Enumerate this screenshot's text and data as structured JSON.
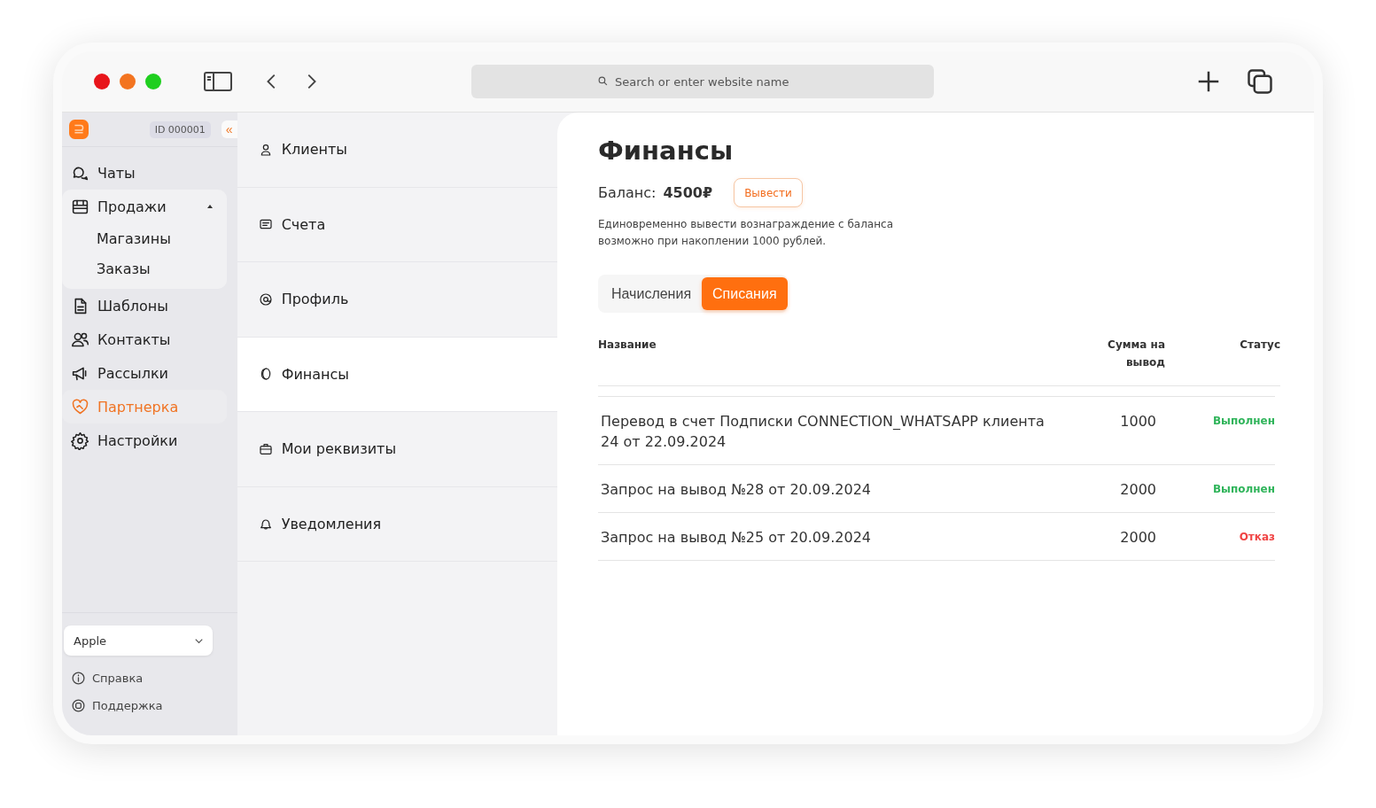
{
  "browser": {
    "search_placeholder": "Search or enter website name"
  },
  "sidebar": {
    "account_id": "ID 000001",
    "collapse": "«",
    "items": [
      {
        "label": "Чаты",
        "kind": "chat",
        "selected": false
      },
      {
        "label": "Продажи",
        "kind": "store",
        "selected": false,
        "expanded": true,
        "children": [
          {
            "label": "Магазины",
            "selected": false
          },
          {
            "label": "Заказы",
            "selected": false
          }
        ]
      },
      {
        "label": "Шаблоны",
        "kind": "doc",
        "selected": false
      },
      {
        "label": "Контакты",
        "kind": "people",
        "selected": false
      },
      {
        "label": "Рассылки",
        "kind": "megaphone",
        "selected": false
      },
      {
        "label": "Партнерка",
        "kind": "heart",
        "selected": true
      },
      {
        "label": "Настройки",
        "kind": "gear",
        "selected": false
      }
    ],
    "company_select": {
      "value": "Apple"
    },
    "footer_links": [
      {
        "label": "Справка",
        "kind": "info"
      },
      {
        "label": "Поддержка",
        "kind": "lifebuoy"
      }
    ]
  },
  "settings_menu": [
    {
      "label": "Клиенты",
      "kind": "user",
      "selected": false
    },
    {
      "label": "Счета",
      "kind": "receipt",
      "selected": false
    },
    {
      "label": "Профиль",
      "kind": "at",
      "selected": false
    },
    {
      "label": "Финансы",
      "kind": "coin",
      "selected": true
    },
    {
      "label": "Мои реквизиты",
      "kind": "briefcase",
      "selected": false
    },
    {
      "label": "Уведомления",
      "kind": "bell",
      "selected": false
    }
  ],
  "finance": {
    "title": "Финансы",
    "balance_label": "Баланс:",
    "balance_value": "4500₽",
    "withdraw_button": "Вывести",
    "note": "Единовременно вывести вознаграждение с баланса возможно при накоплении 1000 рублей.",
    "tabs": [
      {
        "label": "Начисления",
        "selected": false
      },
      {
        "label": "Списания",
        "selected": true
      }
    ],
    "table": {
      "columns": [
        "Название",
        "Сумма на вывод",
        "Статус"
      ],
      "rows": [
        {
          "name": "Перевод в счет Подписки CONNECTION_WHATSAPP клиента 24 от 22.09.2024",
          "amount": "1000",
          "status": "Выполнен",
          "color": "#2fb45a"
        },
        {
          "name": "Запрос на вывод №28 от 20.09.2024",
          "amount": "2000",
          "status": "Выполнен",
          "color": "#2fb45a"
        },
        {
          "name": "Запрос на вывод №25 от 20.09.2024",
          "amount": "2000",
          "status": "Отказ",
          "color": "#f04444"
        }
      ]
    }
  }
}
